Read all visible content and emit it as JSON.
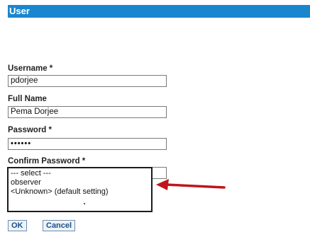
{
  "window": {
    "title": "User"
  },
  "form": {
    "username": {
      "label": "Username *",
      "value": "pdorjee"
    },
    "full_name": {
      "label": "Full Name",
      "value": "Pema Dorjee"
    },
    "password": {
      "label": "Password *",
      "value": "••••••"
    },
    "confirm_password": {
      "label": "Confirm Password *"
    }
  },
  "dropdown": {
    "options": [
      "--- select ---",
      "observer",
      "<Unknown> (default setting)"
    ]
  },
  "buttons": {
    "ok": "OK",
    "cancel": "Cancel"
  },
  "colors": {
    "title_bar": "#1a86d0",
    "annotation_arrow": "#c0141b"
  }
}
